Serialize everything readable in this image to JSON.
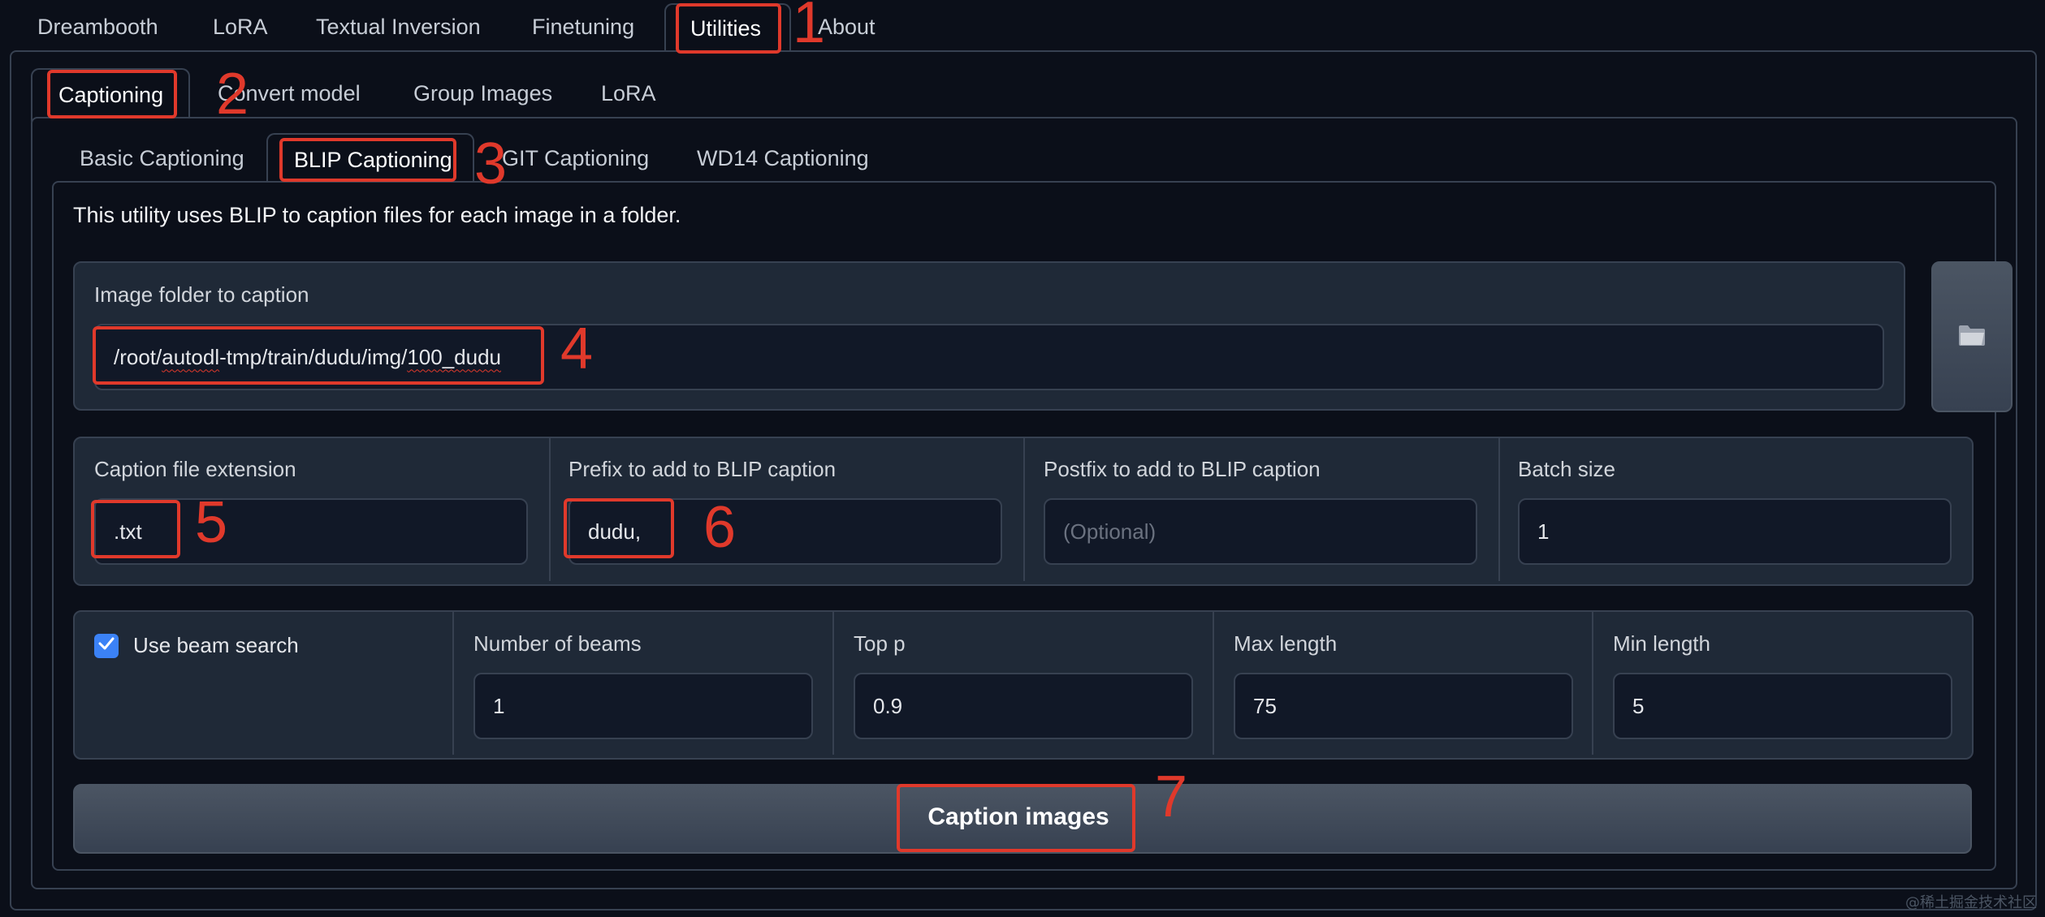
{
  "top_tabs": [
    "Dreambooth",
    "LoRA",
    "Textual Inversion",
    "Finetuning",
    "Utilities",
    "About"
  ],
  "utility_tabs": [
    "Captioning",
    "Convert model",
    "Group Images",
    "LoRA"
  ],
  "caption_tabs": [
    "Basic Captioning",
    "BLIP Captioning",
    "GIT Captioning",
    "WD14 Captioning"
  ],
  "description": "This utility uses BLIP to caption files for each image in a folder.",
  "image_folder": {
    "label": "Image folder to caption",
    "value_parts": [
      "/root/",
      "autodl",
      "-tmp/train/dudu/img/",
      "100_dudu"
    ]
  },
  "caption_ext": {
    "label": "Caption file extension",
    "value": ".txt"
  },
  "prefix": {
    "label": "Prefix to add to BLIP caption",
    "value": "dudu,"
  },
  "postfix": {
    "label": "Postfix to add to BLIP caption",
    "placeholder": "(Optional)"
  },
  "batch_size": {
    "label": "Batch size",
    "value": "1"
  },
  "beam_search": {
    "label": "Use beam search",
    "checked": true
  },
  "num_beams": {
    "label": "Number of beams",
    "value": "1"
  },
  "top_p": {
    "label": "Top p",
    "value": "0.9"
  },
  "max_length": {
    "label": "Max length",
    "value": "75"
  },
  "min_length": {
    "label": "Min length",
    "value": "5"
  },
  "caption_button": "Caption images",
  "annotations": [
    "1",
    "2",
    "3",
    "4",
    "5",
    "6",
    "7"
  ],
  "watermark": "@稀土掘金技术社区",
  "icons": {
    "folder": "folder-icon",
    "check": "checkmark-icon"
  },
  "colors": {
    "accent": "#3b82f6",
    "annotation": "#e0392b",
    "background": "#0b0f19"
  }
}
